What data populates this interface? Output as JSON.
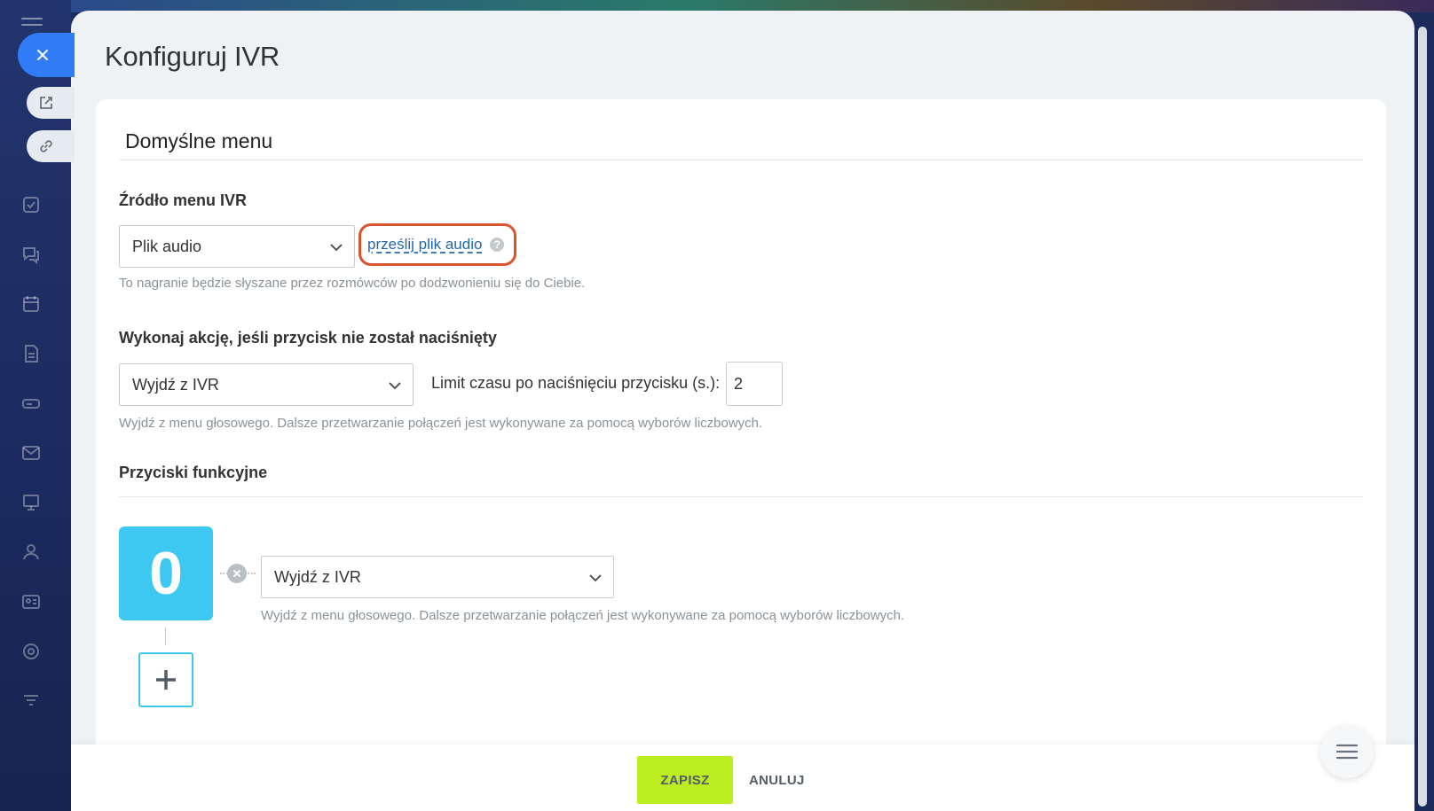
{
  "page": {
    "title": "Konfiguruj IVR"
  },
  "card": {
    "title": "Domyślne menu"
  },
  "source": {
    "label": "Źródło menu IVR",
    "selected": "Plik audio",
    "upload_link": "prześlij plik audio",
    "help": "?",
    "hint": "To nagranie będzie słyszane przez rozmówców po dodzwonieniu się do Ciebie."
  },
  "no_press": {
    "label": "Wykonaj akcję, jeśli przycisk nie został naciśnięty",
    "selected": "Wyjdź z IVR",
    "timeout_label": "Limit czasu po naciśnięciu przycisku (s.):",
    "timeout_value": "2",
    "hint": "Wyjdź z menu głosowego. Dalsze przetwarzanie połączeń jest wykonywane za pomocą wyborów liczbowych."
  },
  "function_keys": {
    "label": "Przyciski funkcyjne",
    "items": [
      {
        "key": "0",
        "action": "Wyjdź z IVR",
        "hint": "Wyjdź z menu głosowego. Dalsze przetwarzanie połączeń jest wykonywane za pomocą wyborów liczbowych."
      }
    ]
  },
  "footer": {
    "save_label": "ZAPISZ",
    "cancel_label": "ANULUJ"
  },
  "colors": {
    "accent_blue": "#2f7cf6",
    "key_cyan": "#3cc8f0",
    "save_green": "#bbed21",
    "highlight_red": "#d9532c",
    "link_blue": "#2067b0"
  },
  "icons": {
    "close": "close-icon",
    "open_new_window": "external-link-icon",
    "copy_link": "link-icon",
    "dropdown": "chevron-down-icon",
    "remove": "remove-icon",
    "add": "plus-icon",
    "menu": "menu-icon"
  }
}
